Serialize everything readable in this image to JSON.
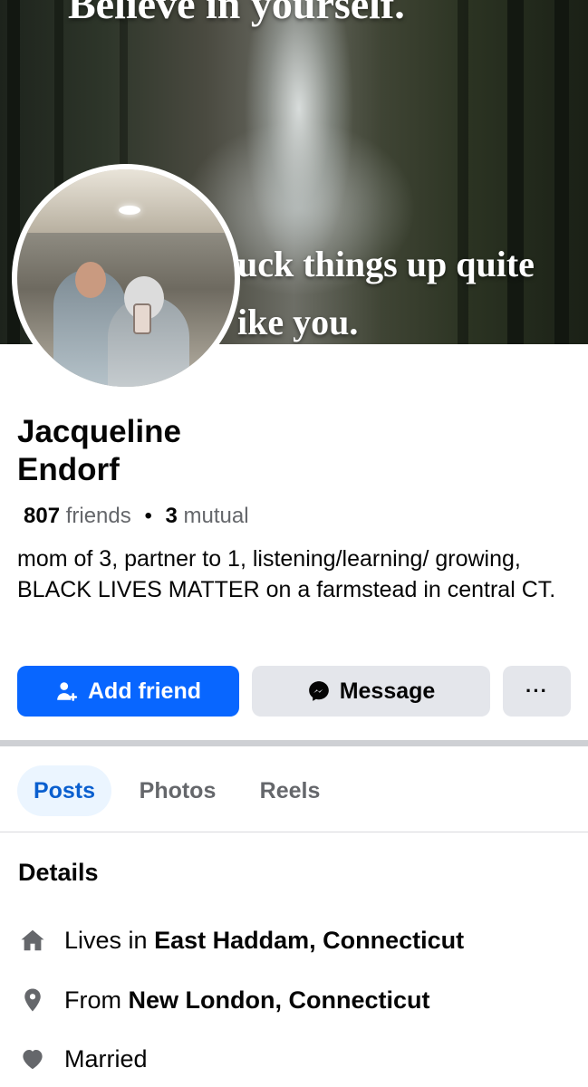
{
  "cover": {
    "line1": "Believe in yourself.",
    "line2": "uck things up quite",
    "line3": "ike you."
  },
  "profile": {
    "name_line1": "Jacqueline",
    "name_line2": "Endorf",
    "friends_count": "807",
    "friends_label": "friends",
    "separator": "•",
    "mutual_count": "3",
    "mutual_label": "mutual",
    "bio": "mom of 3, partner to 1, listening/learning/ growing, BLACK LIVES MATTER on a farmstead in central CT."
  },
  "actions": {
    "add_friend": "Add friend",
    "message": "Message",
    "more": "···",
    "add_friend_icon": "add-person-icon",
    "message_icon": "messenger-icon"
  },
  "tabs": [
    {
      "label": "Posts",
      "active": true
    },
    {
      "label": "Photos",
      "active": false
    },
    {
      "label": "Reels",
      "active": false
    }
  ],
  "details": {
    "title": "Details",
    "lives_prefix": "Lives in",
    "lives_value": "East Haddam, Connecticut",
    "from_prefix": "From",
    "from_value": "New London, Connecticut",
    "relationship": "Married"
  },
  "colors": {
    "primary": "#0866ff",
    "secondary_button": "#e4e6eb",
    "active_tab_bg": "#ebf5ff",
    "active_tab_text": "#0a5fcf",
    "muted_text": "#65676b",
    "icon_gray": "#65676b"
  }
}
